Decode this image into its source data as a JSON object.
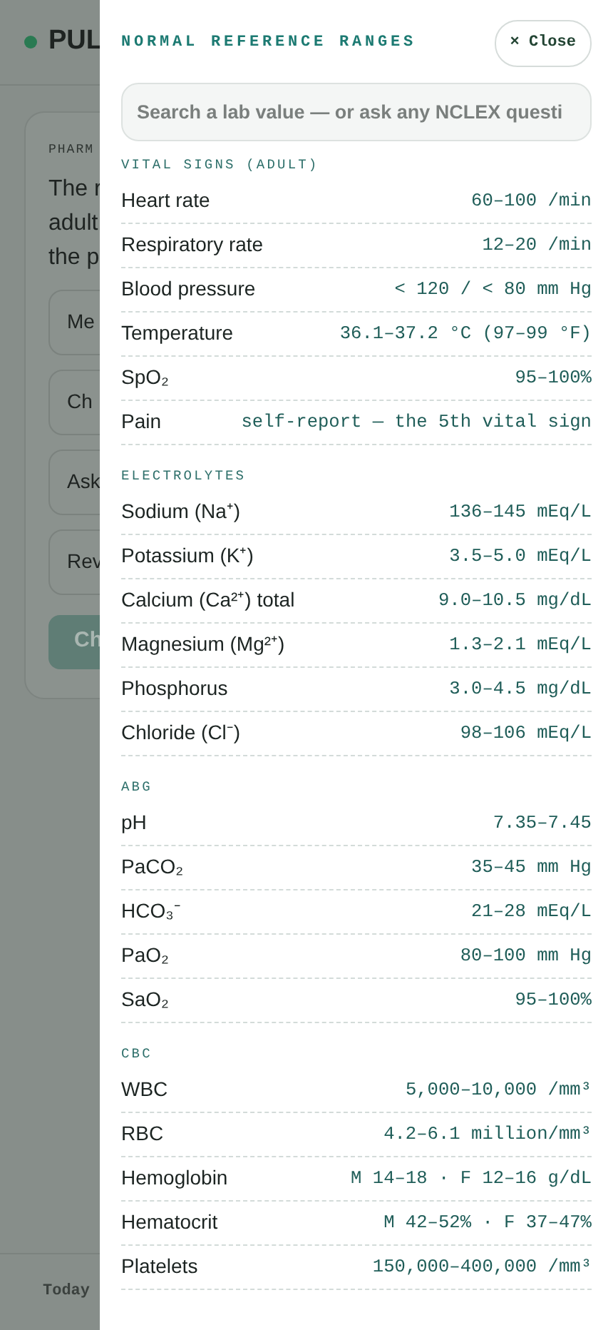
{
  "header": {
    "title": "PUL"
  },
  "question_card": {
    "category": "PHARM",
    "stem_lines": [
      "The r",
      "adult",
      "the p"
    ],
    "options": [
      "Me",
      "Ch",
      "Ask",
      "Rev"
    ],
    "submit_button": "Ch"
  },
  "footer": {
    "label": "Today"
  },
  "drawer": {
    "title": "NORMAL REFERENCE RANGES",
    "close_button": "× Close",
    "search": {
      "placeholder": "Search a lab value — or ask any NCLEX questi"
    },
    "sections": [
      {
        "heading": "VITAL SIGNS (ADULT)",
        "rows": [
          {
            "label": "Heart rate",
            "value": "60–100 /min"
          },
          {
            "label": "Respiratory rate",
            "value": "12–20 /min"
          },
          {
            "label": "Blood pressure",
            "value": "< 120 / < 80 mm Hg"
          },
          {
            "label": "Temperature",
            "value": "36.1–37.2 °C (97–99 °F)"
          },
          {
            "label": "SpO₂",
            "value": "95–100%"
          },
          {
            "label": "Pain",
            "value": "self-report — the 5th vital sign"
          }
        ]
      },
      {
        "heading": "ELECTROLYTES",
        "rows": [
          {
            "label": "Sodium (Na⁺)",
            "value": "136–145 mEq/L"
          },
          {
            "label": "Potassium (K⁺)",
            "value": "3.5–5.0 mEq/L"
          },
          {
            "label": "Calcium (Ca²⁺) total",
            "value": "9.0–10.5 mg/dL"
          },
          {
            "label": "Magnesium (Mg²⁺)",
            "value": "1.3–2.1 mEq/L"
          },
          {
            "label": "Phosphorus",
            "value": "3.0–4.5 mg/dL"
          },
          {
            "label": "Chloride (Cl⁻)",
            "value": "98–106 mEq/L"
          }
        ]
      },
      {
        "heading": "ABG",
        "rows": [
          {
            "label": "pH",
            "value": "7.35–7.45"
          },
          {
            "label": "PaCO₂",
            "value": "35–45 mm Hg"
          },
          {
            "label": "HCO₃⁻",
            "value": "21–28 mEq/L"
          },
          {
            "label": "PaO₂",
            "value": "80–100 mm Hg"
          },
          {
            "label": "SaO₂",
            "value": "95–100%"
          }
        ]
      },
      {
        "heading": "CBC",
        "rows": [
          {
            "label": "WBC",
            "value": "5,000–10,000 /mm³"
          },
          {
            "label": "RBC",
            "value": "4.2–6.1 million/mm³"
          },
          {
            "label": "Hemoglobin",
            "value": "M 14–18 · F 12–16 g/dL"
          },
          {
            "label": "Hematocrit",
            "value": "M 42–52% · F 37–47%"
          },
          {
            "label": "Platelets",
            "value": "150,000–400,000 /mm³"
          }
        ]
      }
    ]
  }
}
